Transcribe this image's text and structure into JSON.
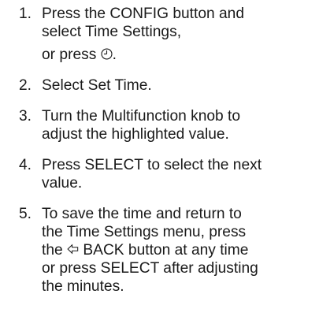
{
  "steps": [
    {
      "number": "1.",
      "line1": "Press the CONFIG button and",
      "line2": "select Time Settings,",
      "line3_prefix": "or press ",
      "line3_suffix": ".",
      "icon": "clock-icon"
    },
    {
      "number": "2.",
      "line1": "Select Set Time."
    },
    {
      "number": "3.",
      "line1": "Turn the Multifunction knob to",
      "line2": "adjust the highlighted value."
    },
    {
      "number": "4.",
      "line1": "Press SELECT to select the next",
      "line2": "value."
    },
    {
      "number": "5.",
      "line1": "To save the time and return to",
      "line2": "the Time Settings menu, press",
      "line3_prefix": "the ",
      "line3_suffix": " BACK button at any time",
      "line4": "or press SELECT after adjusting",
      "line5": "the minutes.",
      "icon": "back-arrow-icon"
    }
  ]
}
